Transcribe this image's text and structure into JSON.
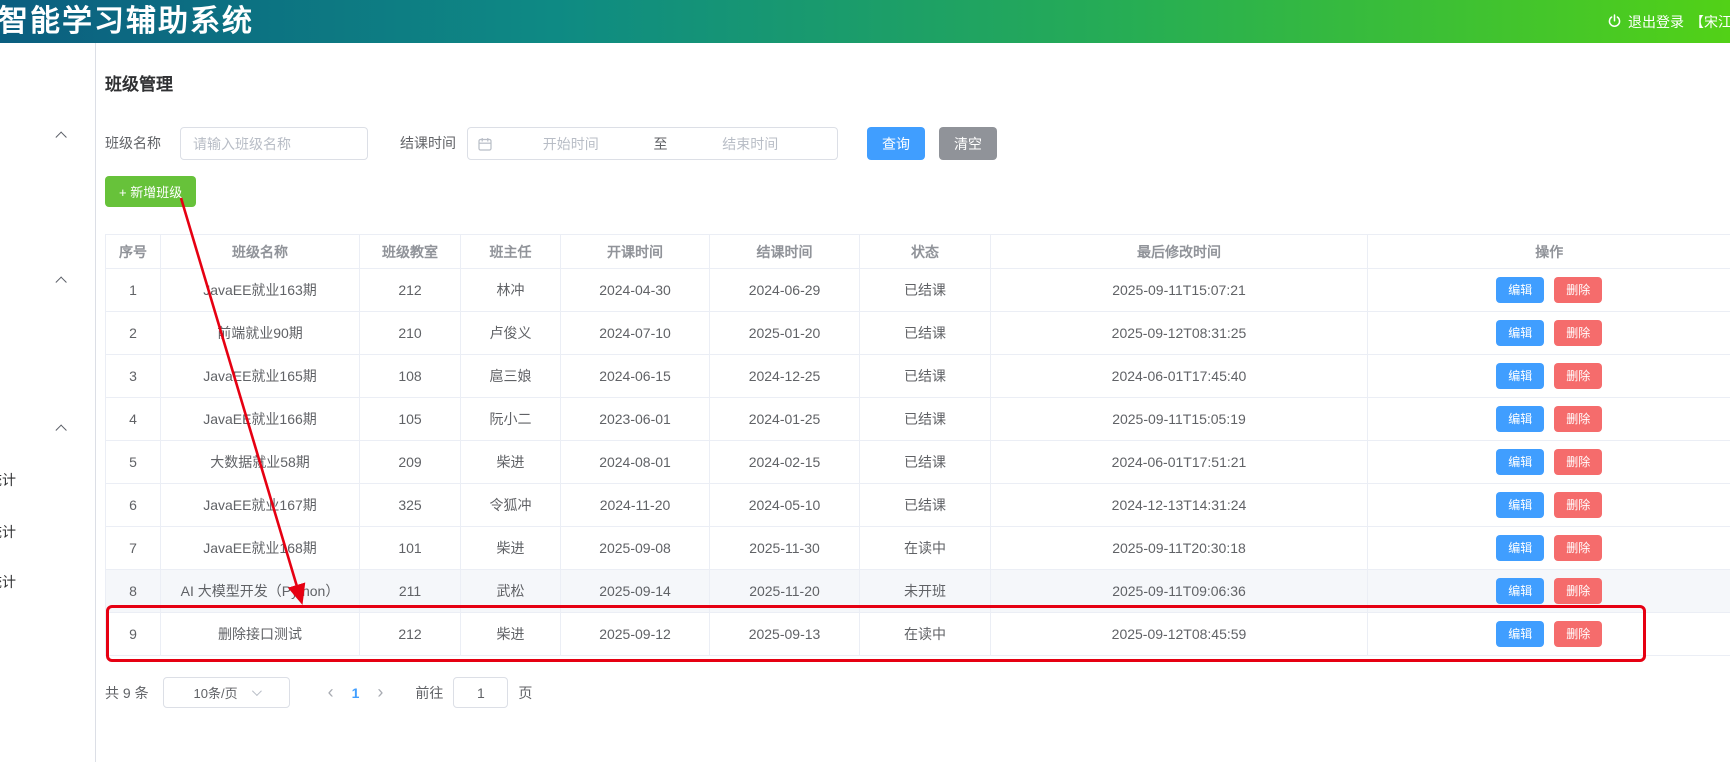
{
  "topbar": {
    "title": "智能学习辅助系统",
    "logout_label": "退出登录",
    "user_label": "【宋江】"
  },
  "sidebar": {
    "items": [
      {
        "label": "统计"
      },
      {
        "label": "统计"
      },
      {
        "label": "统计"
      }
    ]
  },
  "page": {
    "title": "班级管理"
  },
  "filters": {
    "class_name_label": "班级名称",
    "class_name_placeholder": "请输入班级名称",
    "end_time_label": "结课时间",
    "range_start_placeholder": "开始时间",
    "range_separator": "至",
    "range_end_placeholder": "结束时间",
    "search_button": "查询",
    "clear_button": "清空"
  },
  "actions": {
    "add_class_button": "+ 新增班级"
  },
  "table": {
    "headers": [
      "序号",
      "班级名称",
      "班级教室",
      "班主任",
      "开课时间",
      "结课时间",
      "状态",
      "最后修改时间",
      "操作"
    ],
    "edit_button": "编辑",
    "delete_button": "删除",
    "rows": [
      {
        "no": "1",
        "name": "JavaEE就业163期",
        "room": "212",
        "teacher": "林冲",
        "start": "2024-04-30",
        "end": "2024-06-29",
        "status": "已结课",
        "modified": "2025-09-11T15:07:21",
        "highlighted": false,
        "annotated": false
      },
      {
        "no": "2",
        "name": "前端就业90期",
        "room": "210",
        "teacher": "卢俊义",
        "start": "2024-07-10",
        "end": "2025-01-20",
        "status": "已结课",
        "modified": "2025-09-12T08:31:25",
        "highlighted": false,
        "annotated": false
      },
      {
        "no": "3",
        "name": "JavaEE就业165期",
        "room": "108",
        "teacher": "扈三娘",
        "start": "2024-06-15",
        "end": "2024-12-25",
        "status": "已结课",
        "modified": "2024-06-01T17:45:40",
        "highlighted": false,
        "annotated": false
      },
      {
        "no": "4",
        "name": "JavaEE就业166期",
        "room": "105",
        "teacher": "阮小二",
        "start": "2023-06-01",
        "end": "2024-01-25",
        "status": "已结课",
        "modified": "2025-09-11T15:05:19",
        "highlighted": false,
        "annotated": false
      },
      {
        "no": "5",
        "name": "大数据就业58期",
        "room": "209",
        "teacher": "柴进",
        "start": "2024-08-01",
        "end": "2024-02-15",
        "status": "已结课",
        "modified": "2024-06-01T17:51:21",
        "highlighted": false,
        "annotated": false
      },
      {
        "no": "6",
        "name": "JavaEE就业167期",
        "room": "325",
        "teacher": "令狐冲",
        "start": "2024-11-20",
        "end": "2024-05-10",
        "status": "已结课",
        "modified": "2024-12-13T14:31:24",
        "highlighted": false,
        "annotated": false
      },
      {
        "no": "7",
        "name": "JavaEE就业168期",
        "room": "101",
        "teacher": "柴进",
        "start": "2025-09-08",
        "end": "2025-11-30",
        "status": "在读中",
        "modified": "2025-09-11T20:30:18",
        "highlighted": false,
        "annotated": false
      },
      {
        "no": "8",
        "name": "AI 大模型开发（Python）",
        "room": "211",
        "teacher": "武松",
        "start": "2025-09-14",
        "end": "2025-11-20",
        "status": "未开班",
        "modified": "2025-09-11T09:06:36",
        "highlighted": true,
        "annotated": false
      },
      {
        "no": "9",
        "name": "删除接口测试",
        "room": "212",
        "teacher": "柴进",
        "start": "2025-09-12",
        "end": "2025-09-13",
        "status": "在读中",
        "modified": "2025-09-12T08:45:59",
        "highlighted": false,
        "annotated": true
      }
    ]
  },
  "pagination": {
    "total_label": "共 9 条",
    "page_size_label": "10条/页",
    "prev_icon": "‹",
    "current_page": "1",
    "next_icon": "›",
    "goto_label": "前往",
    "goto_value": "1",
    "page_unit": "页"
  },
  "colors": {
    "primary": "#409eff",
    "success": "#67c23a",
    "danger": "#f56c6c",
    "info": "#909399",
    "annotation_red": "#e60012",
    "topbar_gradient_start": "#0b5e80",
    "topbar_gradient_end": "#52d117"
  }
}
